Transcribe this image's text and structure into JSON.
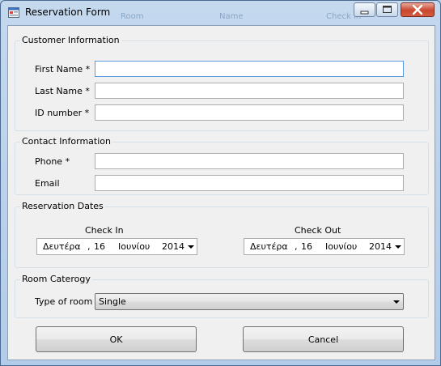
{
  "window": {
    "title": "Reservation Form"
  },
  "background_ghost": [
    "Room",
    "Name",
    "Check In"
  ],
  "customer": {
    "title": "Customer Information",
    "first_name_label": "First Name *",
    "last_name_label": "Last Name *",
    "id_label": "ID number *",
    "first_name_value": "",
    "last_name_value": "",
    "id_value": ""
  },
  "contact": {
    "title": "Contact Information",
    "phone_label": "Phone *",
    "email_label": "Email",
    "phone_value": "",
    "email_value": ""
  },
  "dates": {
    "title": "Reservation Dates",
    "check_in_label": "Check In",
    "check_out_label": "Check Out",
    "check_in": {
      "weekday": "Δευτέρα",
      "sep": ",",
      "day": "16",
      "month": "Ιουνίου",
      "year": "2014"
    },
    "check_out": {
      "weekday": "Δευτέρα",
      "sep": ",",
      "day": "16",
      "month": "Ιουνίου",
      "year": "2014"
    }
  },
  "room": {
    "title": "Room Caterogy",
    "type_label": "Type of room",
    "type_value": "Single"
  },
  "buttons": {
    "ok": "OK",
    "cancel": "Cancel"
  },
  "icons": {
    "app": "form-icon",
    "minimize": "minimize-icon",
    "maximize": "maximize-icon",
    "close": "close-icon",
    "dropdown": "chevron-down-icon"
  },
  "colors": {
    "titlebar": "#b9d1ea",
    "client": "#f0f0f0",
    "close_button": "#c9462e",
    "focus_border": "#569de5"
  }
}
